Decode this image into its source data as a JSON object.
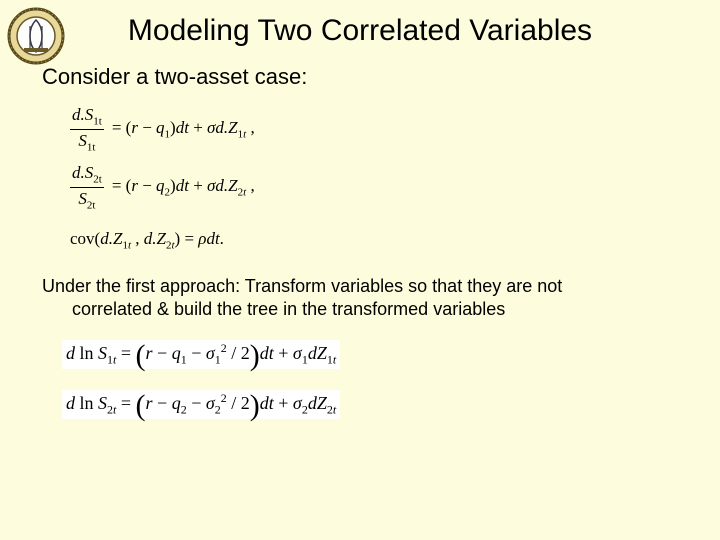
{
  "title": "Modeling Two Correlated Variables",
  "subtitle": "Consider a two-asset case:",
  "eq1": {
    "num": "d.S<sub>1t</sub>",
    "den": "S<sub>1t</sub>",
    "rhs": "= (<span class='it'>r</span> − <span class='it'>q</span><sub>1</sub>)<span class='it'>dt</span> + <span class='it'>σd.Z</span><sub>1<span class='it'>t</span></sub> ,"
  },
  "eq2": {
    "num": "d.S<sub>2t</sub>",
    "den": "S<sub>2t</sub>",
    "rhs": "= (<span class='it'>r</span> − <span class='it'>q</span><sub>2</sub>)<span class='it'>dt</span> + <span class='it'>σd.Z</span><sub>2<span class='it'>t</span></sub> ,"
  },
  "eq3": "cov(<span class='it'>d.Z</span><sub>1<span class='it'>t</span></sub> , <span class='it'>d.Z</span><sub>2<span class='it'>t</span></sub>) = <span class='it'>ρdt</span>.",
  "approach_line1": "Under the first approach: Transform variables so that they are not",
  "approach_line2": "correlated & build the tree in the transformed variables",
  "eq4": "<span class='it'>d</span> ln <span class='it'>S</span><sub>1<span class='it'>t</span></sub> = <span class='bigparen'>(</span><span class='it'>r</span> − <span class='it'>q</span><sub>1</sub> − <span class='it'>σ</span><sub>1</sub><sup>2</sup> / 2<span class='bigparen'>)</span><span class='it'>dt</span> + <span class='it'>σ</span><sub>1</sub><span class='it'>dZ</span><sub>1<span class='it'>t</span></sub>",
  "eq5": "<span class='it'>d</span> ln <span class='it'>S</span><sub>2<span class='it'>t</span></sub> = <span class='bigparen'>(</span><span class='it'>r</span> − <span class='it'>q</span><sub>2</sub> − <span class='it'>σ</span><sub>2</sub><sup>2</sup> / 2<span class='bigparen'>)</span><span class='it'>dt</span> + <span class='it'>σ</span><sub>2</sub><span class='it'>dZ</span><sub>2<span class='it'>t</span></sub>"
}
